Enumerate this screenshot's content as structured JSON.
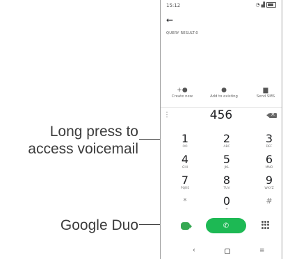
{
  "status": {
    "time": "15:12",
    "icons": [
      "wifi-icon",
      "signal-icon",
      "battery-icon"
    ]
  },
  "header": {
    "back_icon": "back-arrow-icon",
    "query_result": "QUERY RESULT:0"
  },
  "actions": [
    {
      "label": "Create new",
      "icon": "add-person-icon"
    },
    {
      "label": "Add to existing",
      "icon": "person-icon"
    },
    {
      "label": "Send SMS",
      "icon": "message-icon"
    }
  ],
  "dial": {
    "number": "456"
  },
  "keys": [
    {
      "digit": "1",
      "letters": "OO"
    },
    {
      "digit": "2",
      "letters": "ABC"
    },
    {
      "digit": "3",
      "letters": "DEF"
    },
    {
      "digit": "4",
      "letters": "GHI"
    },
    {
      "digit": "5",
      "letters": "JKL"
    },
    {
      "digit": "6",
      "letters": "MNO"
    },
    {
      "digit": "7",
      "letters": "PQRS"
    },
    {
      "digit": "8",
      "letters": "TUV"
    },
    {
      "digit": "9",
      "letters": "WXYZ"
    },
    {
      "digit": "*",
      "letters": ""
    },
    {
      "digit": "0",
      "letters": "+"
    },
    {
      "digit": "#",
      "letters": ""
    }
  ],
  "callouts": {
    "voicemail_line1": "Long press to",
    "voicemail_line2": "access voicemail",
    "duo": "Google Duo"
  },
  "colors": {
    "call_green": "#1db954",
    "duo_green": "#36a852"
  }
}
